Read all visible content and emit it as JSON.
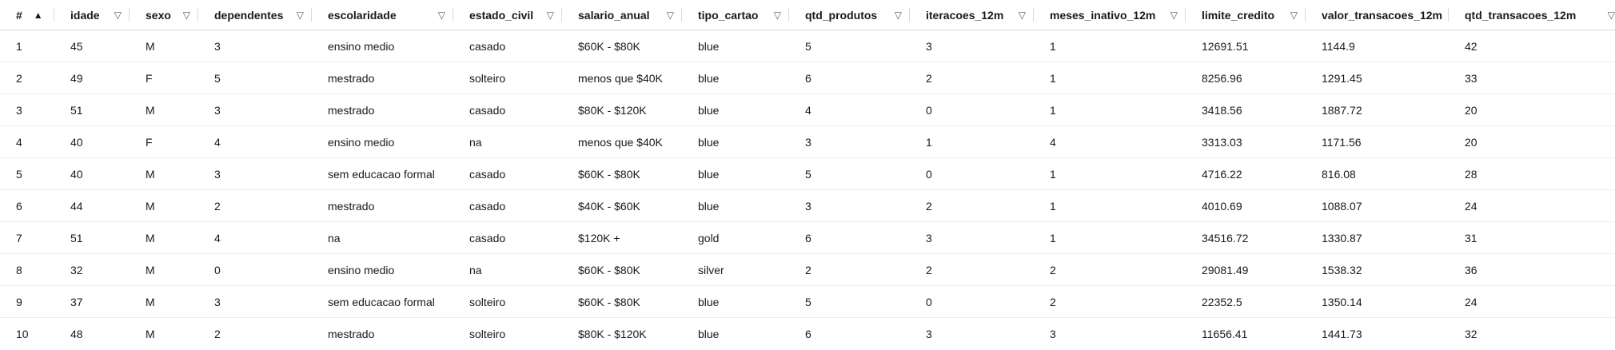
{
  "table": {
    "columns": [
      {
        "key": "idx",
        "label": "#",
        "sort": "asc"
      },
      {
        "key": "idade",
        "label": "idade",
        "sort": "none"
      },
      {
        "key": "sexo",
        "label": "sexo",
        "sort": "none"
      },
      {
        "key": "dependentes",
        "label": "dependentes",
        "sort": "none"
      },
      {
        "key": "escolaridade",
        "label": "escolaridade",
        "sort": "none"
      },
      {
        "key": "estado_civil",
        "label": "estado_civil",
        "sort": "none"
      },
      {
        "key": "salario_anual",
        "label": "salario_anual",
        "sort": "none"
      },
      {
        "key": "tipo_cartao",
        "label": "tipo_cartao",
        "sort": "none"
      },
      {
        "key": "qtd_produtos",
        "label": "qtd_produtos",
        "sort": "none"
      },
      {
        "key": "iteracoes_12m",
        "label": "iteracoes_12m",
        "sort": "none"
      },
      {
        "key": "meses_inativo_12m",
        "label": "meses_inativo_12m",
        "sort": "none"
      },
      {
        "key": "limite_credito",
        "label": "limite_credito",
        "sort": "none"
      },
      {
        "key": "valor_transacoes_12m",
        "label": "valor_transacoes_12m",
        "sort": "none"
      },
      {
        "key": "qtd_transacoes_12m",
        "label": "qtd_transacoes_12m",
        "sort": "none"
      }
    ],
    "sort_icons": {
      "asc": "▲",
      "none": "▽"
    },
    "rows": [
      [
        "1",
        "45",
        "M",
        "3",
        "ensino medio",
        "casado",
        "$60K - $80K",
        "blue",
        "5",
        "3",
        "1",
        "12691.51",
        "1144.9",
        "42"
      ],
      [
        "2",
        "49",
        "F",
        "5",
        "mestrado",
        "solteiro",
        "menos que $40K",
        "blue",
        "6",
        "2",
        "1",
        "8256.96",
        "1291.45",
        "33"
      ],
      [
        "3",
        "51",
        "M",
        "3",
        "mestrado",
        "casado",
        "$80K - $120K",
        "blue",
        "4",
        "0",
        "1",
        "3418.56",
        "1887.72",
        "20"
      ],
      [
        "4",
        "40",
        "F",
        "4",
        "ensino medio",
        "na",
        "menos que $40K",
        "blue",
        "3",
        "1",
        "4",
        "3313.03",
        "1171.56",
        "20"
      ],
      [
        "5",
        "40",
        "M",
        "3",
        "sem educacao formal",
        "casado",
        "$60K - $80K",
        "blue",
        "5",
        "0",
        "1",
        "4716.22",
        "816.08",
        "28"
      ],
      [
        "6",
        "44",
        "M",
        "2",
        "mestrado",
        "casado",
        "$40K - $60K",
        "blue",
        "3",
        "2",
        "1",
        "4010.69",
        "1088.07",
        "24"
      ],
      [
        "7",
        "51",
        "M",
        "4",
        "na",
        "casado",
        "$120K +",
        "gold",
        "6",
        "3",
        "1",
        "34516.72",
        "1330.87",
        "31"
      ],
      [
        "8",
        "32",
        "M",
        "0",
        "ensino medio",
        "na",
        "$60K - $80K",
        "silver",
        "2",
        "2",
        "2",
        "29081.49",
        "1538.32",
        "36"
      ],
      [
        "9",
        "37",
        "M",
        "3",
        "sem educacao formal",
        "solteiro",
        "$60K - $80K",
        "blue",
        "5",
        "0",
        "2",
        "22352.5",
        "1350.14",
        "24"
      ],
      [
        "10",
        "48",
        "M",
        "2",
        "mestrado",
        "solteiro",
        "$80K - $120K",
        "blue",
        "6",
        "3",
        "3",
        "11656.41",
        "1441.73",
        "32"
      ]
    ]
  }
}
